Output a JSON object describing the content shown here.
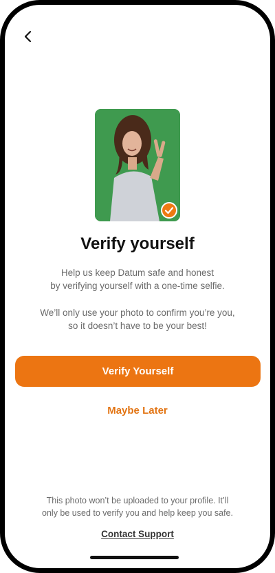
{
  "header": {
    "back_icon": "chevron-left-icon"
  },
  "hero": {
    "photo": "selfie-photo",
    "badge_icon": "verified-check-icon",
    "badge_color": "#ee7a12"
  },
  "content": {
    "title": "Verify yourself",
    "subtitle_line1": "Help us keep Datum safe and honest",
    "subtitle_line2": "by verifying yourself with a one-time selfie.",
    "note_line1": "We’ll only use your photo to confirm you’re you,",
    "note_line2": "so it doesn’t have to be your best!"
  },
  "actions": {
    "primary_label": "Verify Yourself",
    "secondary_label": "Maybe Later",
    "accent_color": "#ec7512"
  },
  "footer": {
    "note_line1": "This photo won’t be uploaded to your profile. It’ll",
    "note_line2": "only be used to verify you and help keep you safe.",
    "support_label": "Contact Support"
  }
}
